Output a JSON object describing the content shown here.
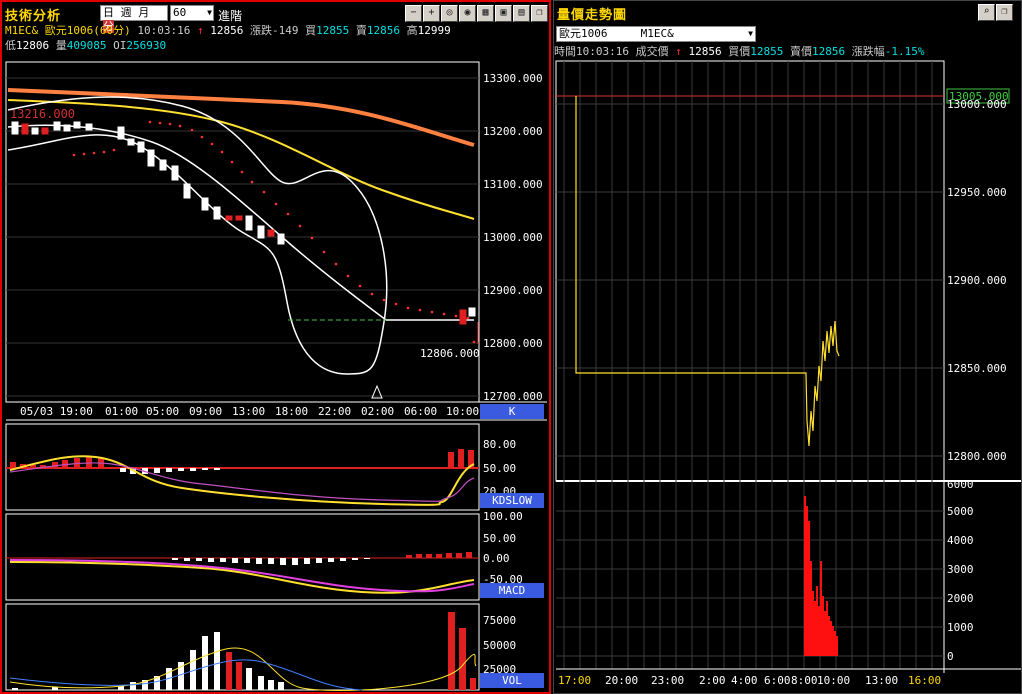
{
  "left": {
    "title": "技術分析",
    "period_tabs": [
      "日",
      "週",
      "月",
      "分"
    ],
    "interval": "60",
    "advanced_label": "進階",
    "row1": {
      "symbol": "M1EC&",
      "name": "歐元1006(60分)",
      "time": "10:03:16",
      "price": "12856",
      "change": "漲跌-149",
      "bid_label": "買",
      "bid": "12855",
      "ask_label": "賣",
      "ask": "12856",
      "high_label": "高",
      "high": "12999"
    },
    "row2": {
      "low_label": "低",
      "low": "12806",
      "vol_label": "量",
      "vol": "409085",
      "oi_label": "OI",
      "oi": "256930"
    },
    "price_axis": [
      "13300.000",
      "13200.000",
      "13100.000",
      "13000.000",
      "12900.000",
      "12800.000",
      "12700.000"
    ],
    "ghost_label": "13216.000",
    "low_marker": "12806.000",
    "time_axis": [
      "05/03 19:00",
      "01:00",
      "05:00",
      "09:00",
      "13:00",
      "18:00",
      "22:00",
      "02:00",
      "06:00",
      "10:00"
    ],
    "panel_k": "K",
    "kd_axis": [
      "80.00",
      "50.00",
      "20.00"
    ],
    "panel_kd": "KDSLOW",
    "macd_axis": [
      "100.00",
      "50.00",
      "0.00",
      "-50.00"
    ],
    "panel_macd": "MACD",
    "vol_axis": [
      "75000",
      "50000",
      "25000"
    ],
    "panel_vol": "VOL"
  },
  "right": {
    "title": "量價走勢圖",
    "product": "歐元1006",
    "symbol": "M1EC&",
    "info": {
      "time_label": "時間",
      "time": "10:03:16",
      "deal_label": "成交價",
      "deal": "12856",
      "bid_label": "買價",
      "bid": "12855",
      "ask_label": "賣價",
      "ask": "12856",
      "pct_label": "漲跌幅",
      "pct": "-1.15%"
    },
    "ref_price": "13005.000",
    "price_axis": [
      "13000.000",
      "12950.000",
      "12900.000",
      "12850.000",
      "12800.000"
    ],
    "vol_axis": [
      "6000",
      "5000",
      "4000",
      "3000",
      "2000",
      "1000",
      "0"
    ],
    "time_axis": [
      "17:00",
      "20:00",
      "23:00",
      "2:00",
      "4:00",
      "6:00",
      "8:00",
      "10:00",
      "13:00",
      "16:00"
    ]
  },
  "colors": {
    "accent_red": "#ff2020",
    "yellow": "#ffe030",
    "orange": "#ff8040",
    "cyan": "#00e0e0",
    "panel_blue": "#3a5be0"
  }
}
